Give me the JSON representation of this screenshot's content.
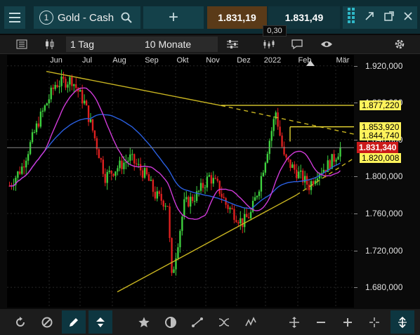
{
  "toolbar": {
    "instrument_number": "1",
    "instrument_name": "Gold - Cash",
    "add_label": "+",
    "bid": "1.831,19",
    "ask": "1.831,49",
    "spread": "0,30"
  },
  "second_bar": {
    "interval": "1 Tag",
    "range": "10 Monate"
  },
  "chart_data": {
    "type": "candlestick",
    "x_labels": [
      "Jun",
      "Jul",
      "Aug",
      "Sep",
      "Okt",
      "Nov",
      "Dez",
      "2022",
      "Feb",
      "Mär"
    ],
    "y_ticks": [
      "1.920,000",
      "1.880,000",
      "1.840,000",
      "1.800,000",
      "1.760,000",
      "1.720,000",
      "1.680,000"
    ],
    "y_values": [
      1920,
      1880,
      1840,
      1800,
      1760,
      1720,
      1680
    ],
    "ylim": [
      1658,
      1932
    ],
    "current_price_label": "1.831,340",
    "current_price": 1831.34,
    "level_tags": [
      {
        "label": "1.877,220",
        "value": 1877.22
      },
      {
        "label": "1.853,920",
        "value": 1853.92
      },
      {
        "label": "1.844,740",
        "value": 1844.74
      },
      {
        "label": "1.820,008",
        "value": 1820.008
      }
    ],
    "series": [
      {
        "type": "moving-average",
        "color": "#2a5fe0"
      },
      {
        "type": "moving-average",
        "color": "#d03ad8"
      }
    ],
    "colors": {
      "up": "#3fd13f",
      "down": "#e02020",
      "trend": "#c8b420",
      "current": "#cc1a1a",
      "tag_bg": "#fff35c"
    }
  },
  "icons": {
    "top": [
      "menu-icon",
      "search-icon",
      "popout-icon",
      "maximize-icon",
      "close-icon",
      "layout-icon"
    ],
    "bottom": [
      "refresh-icon",
      "cancel-icon",
      "pencil-icon",
      "triangle-icon",
      "star-icon",
      "contrast-icon",
      "line-tool-icon",
      "wave-icon",
      "zigzag-icon",
      "move-icon",
      "minus-icon",
      "plus-icon",
      "crosshair-icon",
      "vertical-arrow-icon"
    ]
  }
}
